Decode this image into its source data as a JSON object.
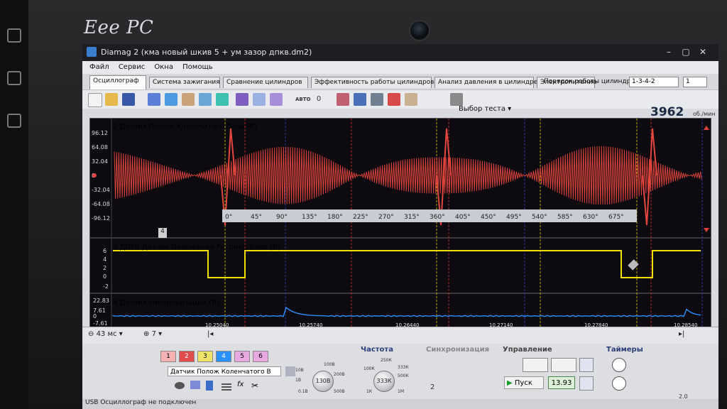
{
  "brand": "Eee PC",
  "window": {
    "title": "Diamag 2 (кма новый шкив 5 + ум зазор дпкв.dm2)",
    "controls": [
      "–",
      "▢",
      "✕"
    ]
  },
  "menu": [
    "Файл",
    "Сервис",
    "Окна",
    "Помощь"
  ],
  "tabs": [
    {
      "label": "Осциллограф",
      "active": true
    },
    {
      "label": "Система зажигания"
    },
    {
      "label": "Сравнение цилиндров"
    },
    {
      "label": "Эффективность работы цилиндров"
    },
    {
      "label": "Анализ давления в цилиндре"
    },
    {
      "label": "Электропитание"
    }
  ],
  "firing_order": {
    "label": "Порядок работы цилиндров",
    "value": "1-3-4-2",
    "count": "1"
  },
  "toolbar": {
    "test_select": "Выбор теста",
    "auto_label": "АВТО",
    "zero_label": "0"
  },
  "rpm": {
    "value": "3962",
    "unit": "об./мин"
  },
  "channels": [
    {
      "label": "2 Датчик Полож Коленчатого Вала (В)",
      "color": "#e3463e",
      "ticks": [
        "96.12",
        "64.08",
        "32.04",
        "0",
        "-32.04",
        "-64.08",
        "-96.12"
      ]
    },
    {
      "label": "3 ДПРВ Датчик Положения Распред Вала (В)",
      "color": "#f0e000",
      "ticks": [
        "6",
        "4",
        "2",
        "0",
        "-2"
      ]
    },
    {
      "label": "4 Датчик синхронизации (В)",
      "color": "#2a8fff",
      "ticks": [
        "22.83",
        "7.61",
        "0",
        "-7.61"
      ]
    }
  ],
  "cursor_value": "4",
  "degree_ticks": [
    "0°",
    "45°",
    "90°",
    "135°",
    "180°",
    "225°",
    "270°",
    "315°",
    "360°",
    "405°",
    "450°",
    "495°",
    "540°",
    "585°",
    "630°",
    "675°"
  ],
  "time_ticks": [
    "10.25040",
    "10.25740",
    "10.26440",
    "10.27140",
    "10.27840",
    "10.28540"
  ],
  "bottom": {
    "timebase": "43 мс",
    "zoom": "7"
  },
  "panel": {
    "channel_buttons": [
      "1",
      "2",
      "3",
      "4",
      "5",
      "6"
    ],
    "channel_name": "Датчик Полож Коленчатого В",
    "volts_knob": "130В",
    "volt_scale": [
      "10В",
      "100В",
      "1В",
      "200В",
      "0.1В",
      "500В"
    ],
    "freq_label": "Частота",
    "freq_knob": "333К",
    "freq_scale": [
      "250К",
      "100К",
      "333К",
      "500К",
      "1К",
      "1М"
    ],
    "sync_label": "Синхронизация",
    "sync_value": "2",
    "control_label": "Управление",
    "start_label": "Пуск",
    "start_value": "13.93",
    "timers_label": "Таймеры",
    "version": "2.0"
  },
  "status": "USB Осциллограф не подключен"
}
